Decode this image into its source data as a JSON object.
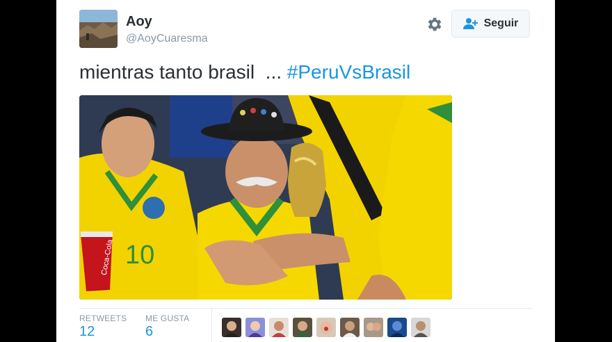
{
  "user": {
    "name": "Aoy",
    "handle": "@AoyCuaresma"
  },
  "actions": {
    "follow_label": "Seguir",
    "settings_icon": "gear-icon",
    "follow_icon": "person-plus-icon"
  },
  "tweet": {
    "text": "mientras tanto brasil  ... ",
    "hashtag": "#PeruVsBrasil"
  },
  "stats": {
    "retweets_label": "RETWEETS",
    "retweets_value": "12",
    "likes_label": "ME GUSTA",
    "likes_value": "6"
  },
  "photo_text": {
    "jersey_number": "10",
    "cup_brand": "Coca-Cola"
  },
  "colors": {
    "link": "#1b95e0",
    "text": "#292f33",
    "muted": "#8899a6",
    "border": "#e1e8ed",
    "jersey_yellow": "#f2d300",
    "jersey_green": "#2f8f3a"
  }
}
